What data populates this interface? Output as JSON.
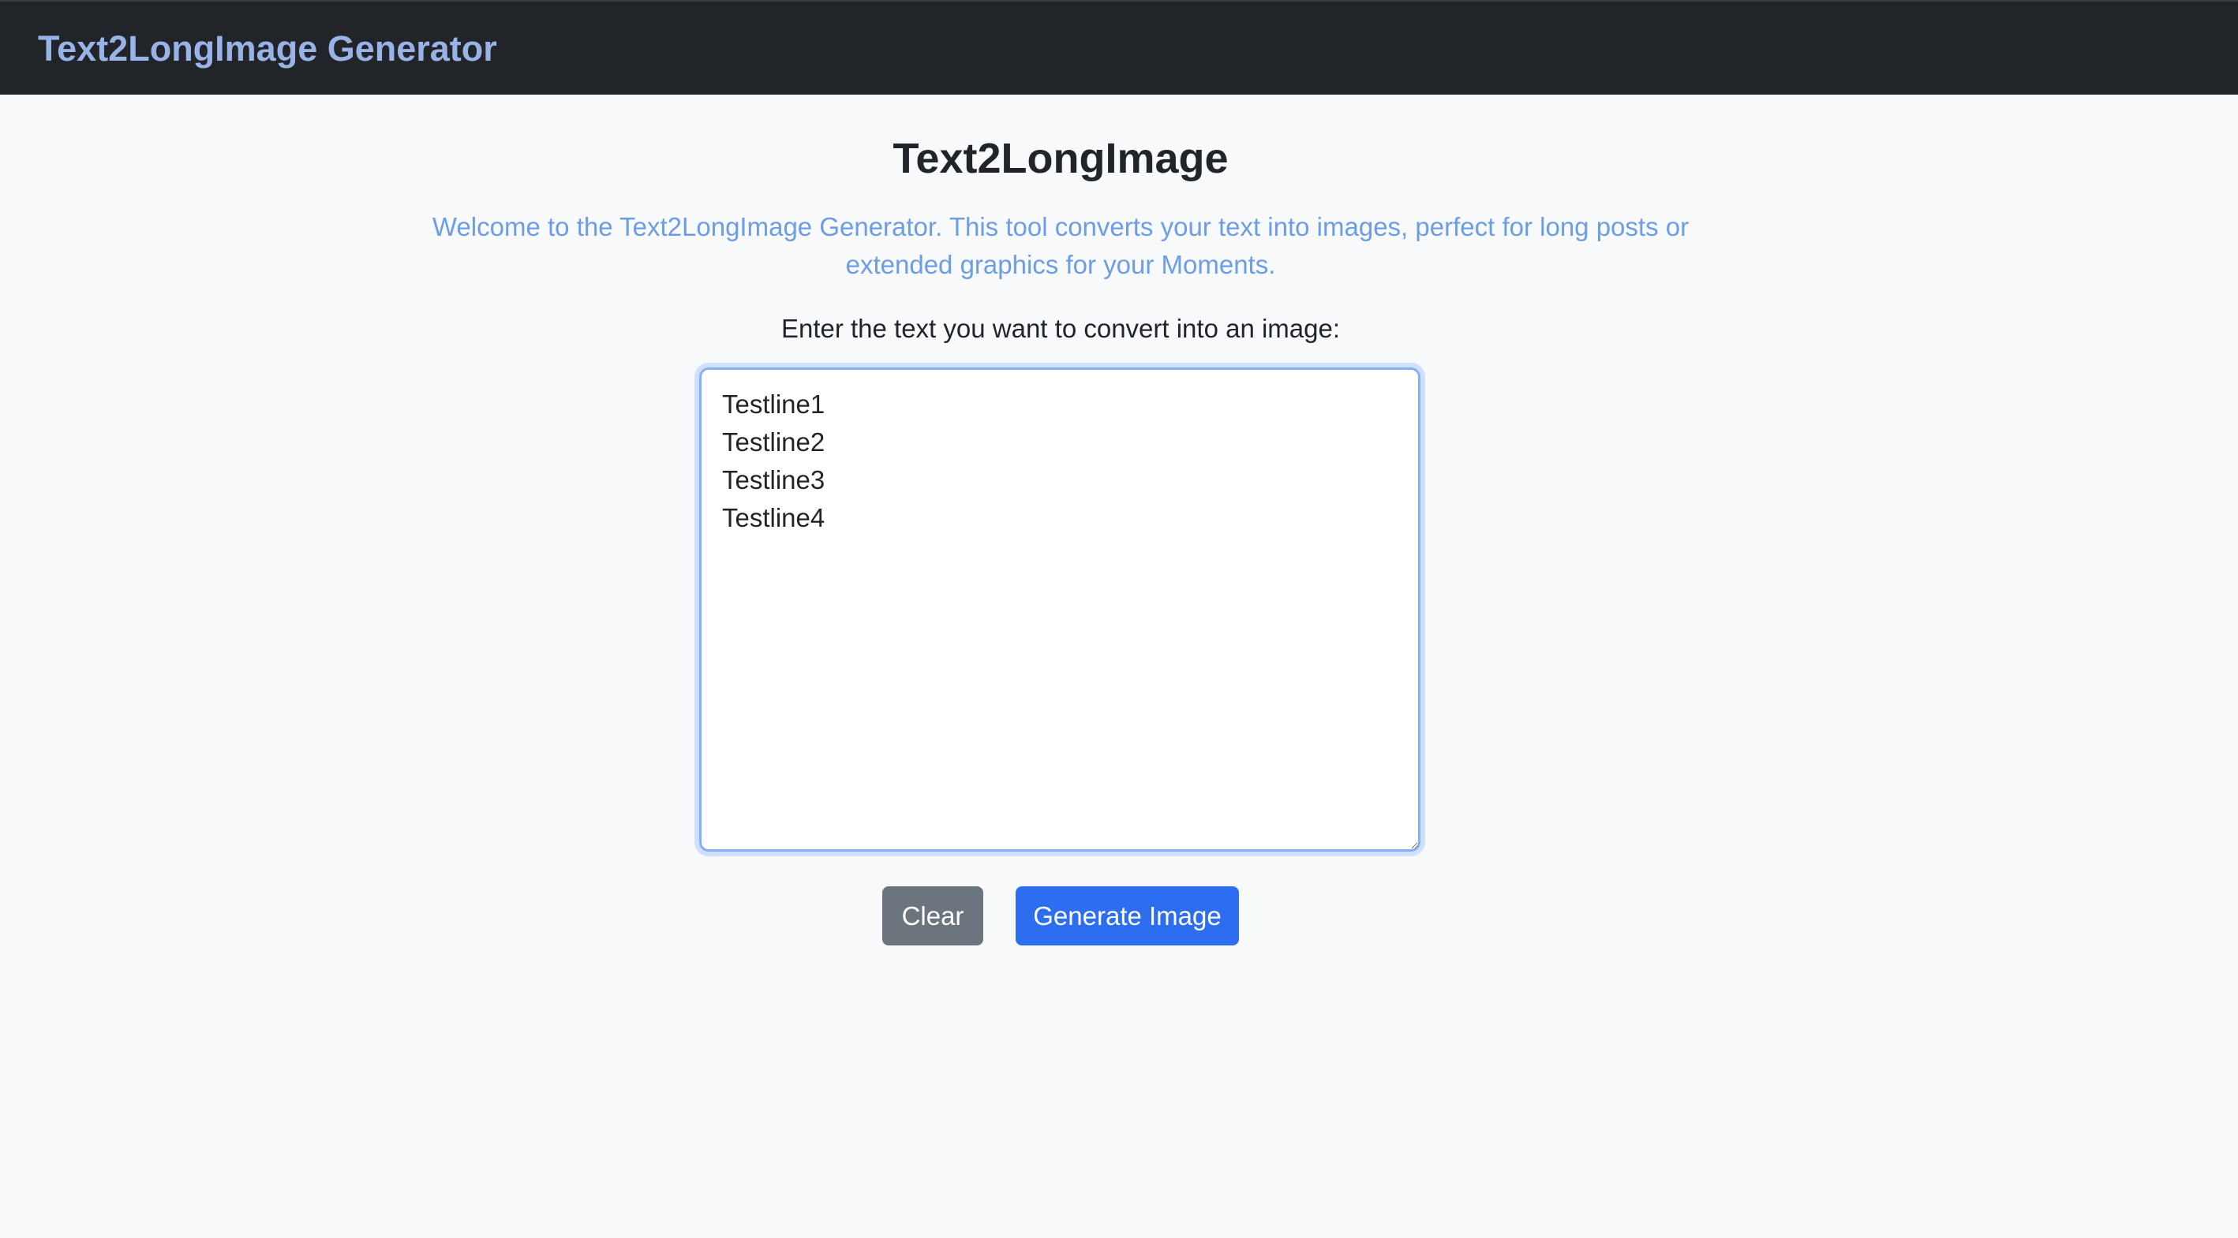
{
  "navbar": {
    "brand": "Text2LongImage Generator"
  },
  "main": {
    "title": "Text2LongImage",
    "welcome": "Welcome to the Text2LongImage Generator. This tool converts your text into images, perfect for long posts or extended graphics for your Moments.",
    "prompt_label": "Enter the text you want to convert into an image:",
    "text_input": {
      "value": "Testline1\nTestline2\nTestline3\nTestline4"
    }
  },
  "buttons": {
    "clear_label": "Clear",
    "generate_label": "Generate Image"
  },
  "colors": {
    "navbar_bg": "#212529",
    "brand": "#9ab3e6",
    "welcome_text": "#6c9de6",
    "clear_button": "#6c757d",
    "generate_button": "#2d6ef0"
  }
}
